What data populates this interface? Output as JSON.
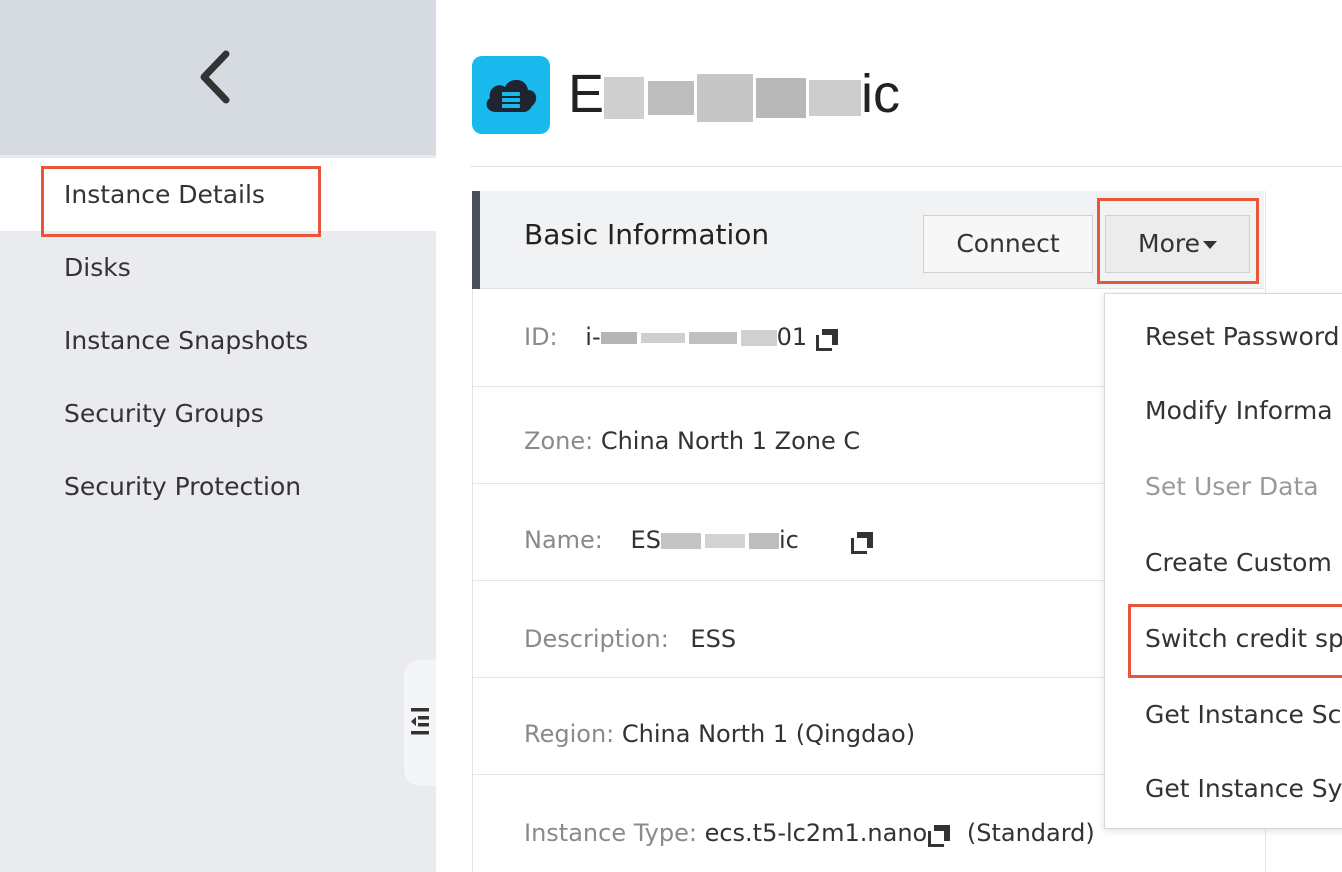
{
  "sidebar": {
    "items": [
      {
        "label": "Instance Details",
        "active": true
      },
      {
        "label": "Disks"
      },
      {
        "label": "Instance Snapshots"
      },
      {
        "label": "Security Groups"
      },
      {
        "label": "Security Protection"
      }
    ]
  },
  "header": {
    "title_start": "E",
    "title_end": "ic"
  },
  "panel": {
    "title": "Basic Information",
    "connect_label": "Connect",
    "more_label": "More",
    "rows": {
      "id": {
        "label": "ID:",
        "value_start": "i-",
        "value_end": "01"
      },
      "zone": {
        "label": "Zone:",
        "value": "China North 1 Zone C"
      },
      "name": {
        "label": "Name:",
        "value_start": "ES",
        "value_end": "ic"
      },
      "description": {
        "label": "Description:",
        "value": "ESS"
      },
      "region": {
        "label": "Region:",
        "value": "China North 1 (Qingdao)"
      },
      "instance_type": {
        "label": "Instance Type:",
        "value": "ecs.t5-lc2m1.nano",
        "suffix": "(Standard)"
      }
    }
  },
  "more_menu": {
    "items": [
      {
        "label": "Reset Password"
      },
      {
        "label": "Modify Informa"
      },
      {
        "label": "Set User Data",
        "disabled": true
      },
      {
        "label": "Create Custom"
      },
      {
        "label": "Switch credit sp"
      },
      {
        "label": "Get Instance Sc"
      },
      {
        "label": "Get Instance Sy"
      }
    ]
  },
  "colors": {
    "highlight": "#e8563a",
    "accent_blue": "#19b9ee"
  },
  "icons": {
    "back": "chevron-left-icon",
    "collapse": "collapse-sidebar-icon",
    "copy": "copy-icon",
    "product": "cloud-server-icon"
  }
}
